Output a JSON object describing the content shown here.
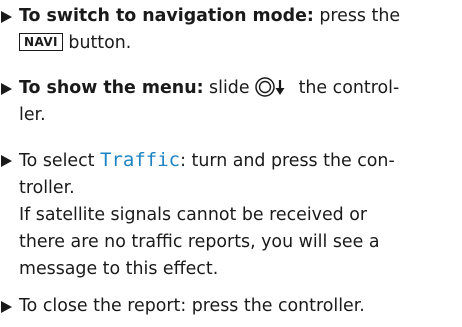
{
  "steps": [
    {
      "bold": "To switch to navigation mode:",
      "text_before_key": " press the",
      "key_label": "NAVI",
      "text_after_key": " button."
    },
    {
      "bold": "To show the menu:",
      "text_before_icon": " slide ",
      "icon": "controller-slide-down-icon",
      "text_after_icon": " the control-",
      "text_line2": "ler."
    },
    {
      "text_before": "To select ",
      "menu_item": "Traffic",
      "text_after": ": turn and press the con-",
      "text_line2": "troller.",
      "note_line1": "If satellite signals cannot be received or",
      "note_line2": "there are no traffic reports, you will see a",
      "note_line3": "message to this effect."
    },
    {
      "text": "To close the report: press the controller."
    }
  ],
  "colors": {
    "text": "#1a1a1a",
    "menu_term": "#1f84c3"
  },
  "icons": {
    "bullet": "triangle-bullet-icon"
  }
}
